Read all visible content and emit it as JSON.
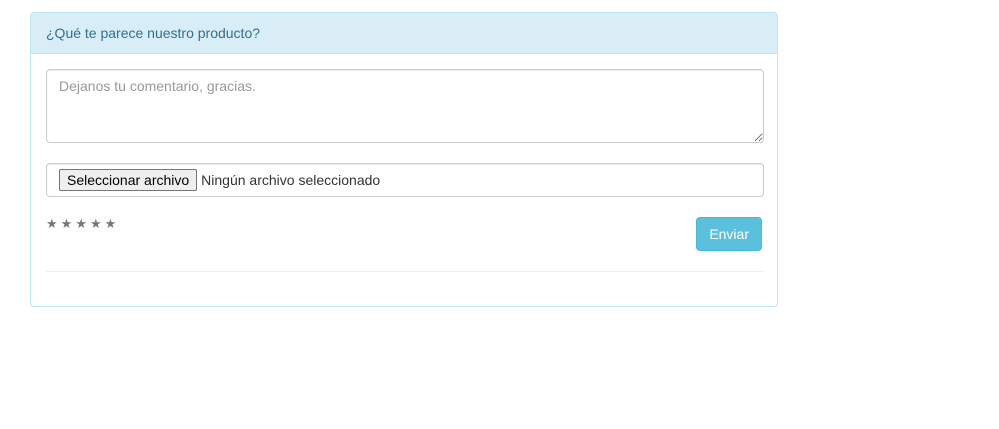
{
  "panel": {
    "title": "¿Qué te parece nuestro producto?",
    "header_bg": "#d9edf7",
    "header_text_color": "#31708f",
    "border_color": "#bce8f1"
  },
  "comment": {
    "placeholder": "Dejanos tu comentario, gracias.",
    "value": ""
  },
  "file_input": {
    "button_label": "Seleccionar archivo",
    "status": "Ningún archivo seleccionado"
  },
  "rating": {
    "stars": [
      "★",
      "★",
      "★",
      "★",
      "★"
    ],
    "max": 5,
    "value": 0,
    "star_color": "#777777"
  },
  "submit": {
    "label": "Enviar",
    "color": "#5bc0de"
  }
}
